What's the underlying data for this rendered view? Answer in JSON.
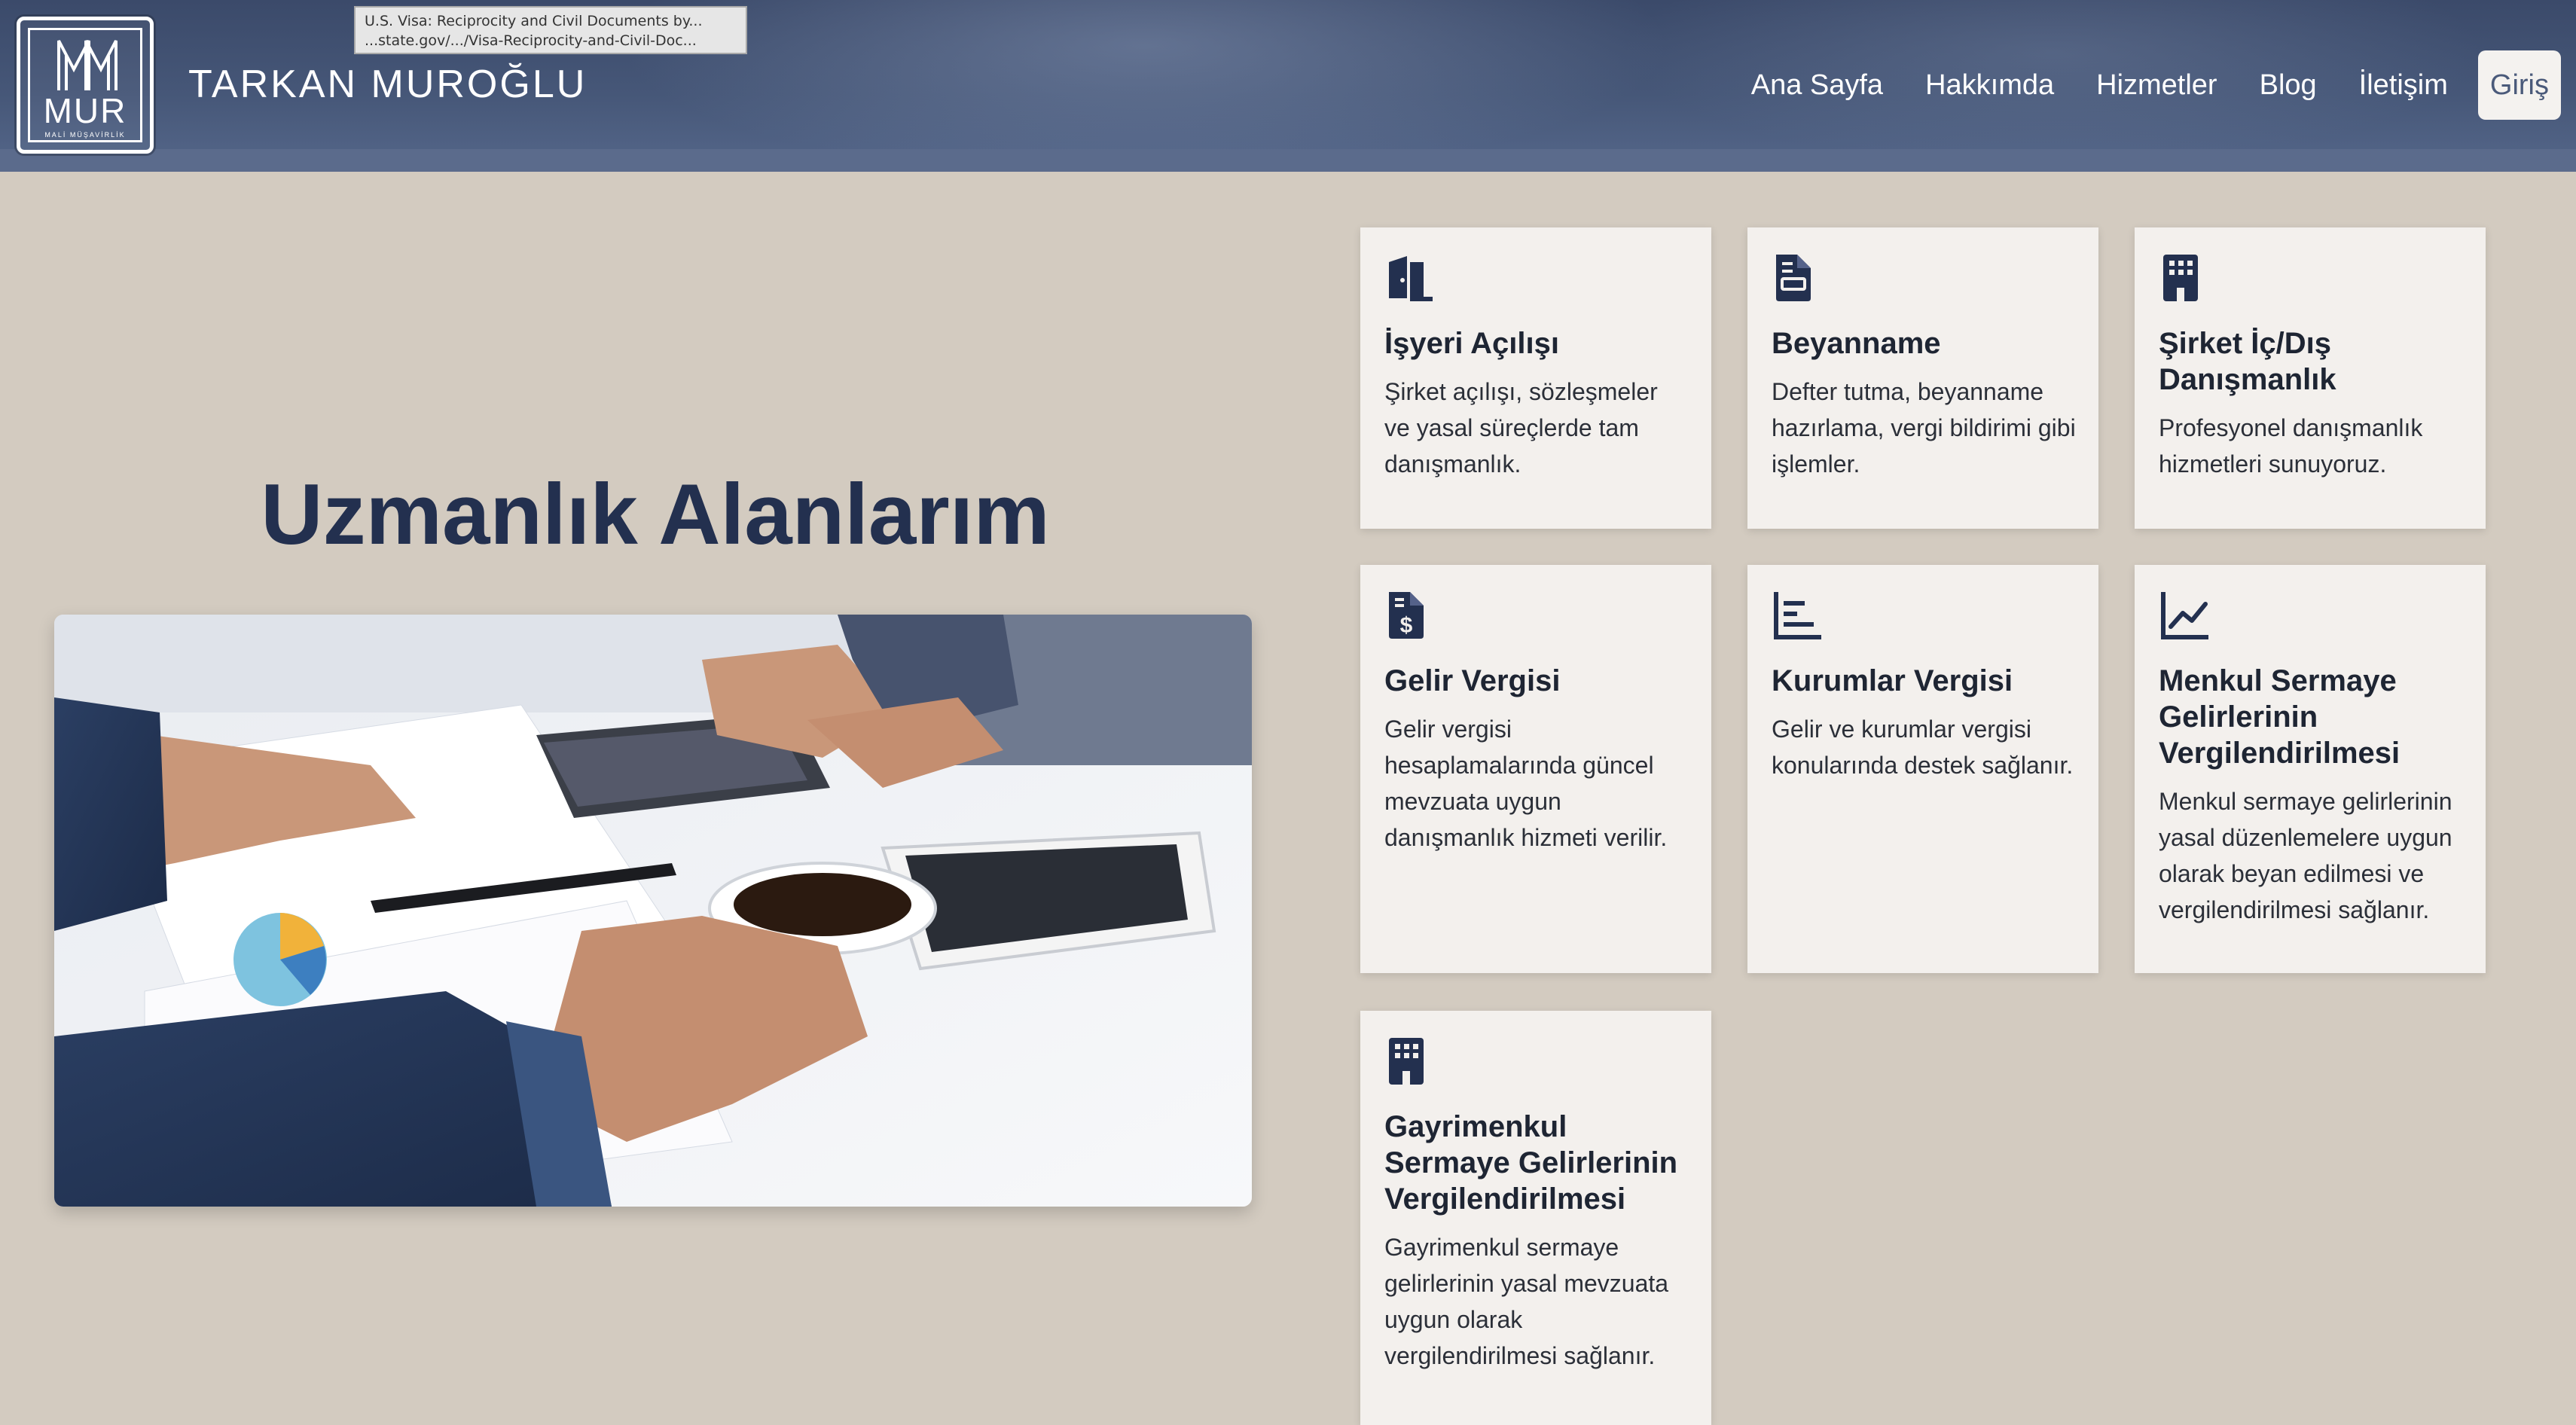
{
  "header": {
    "logo_text": "MUR",
    "logo_subtext": "MALİ MÜŞAVİRLİK",
    "site_name": "TARKAN MUROĞLU",
    "nav": {
      "home": "Ana Sayfa",
      "about": "Hakkımda",
      "services": "Hizmetler",
      "blog": "Blog",
      "contact": "İletişim",
      "login": "Giriş"
    }
  },
  "tooltip": {
    "line1": "U.S. Visa: Reciprocity and Civil Documents by...",
    "line2": "...state.gov/.../Visa-Reciprocity-and-Civil-Doc..."
  },
  "main": {
    "title_bold": "Uzmanlık",
    "title_regular": "Alanlarım"
  },
  "services": [
    {
      "icon": "door-icon",
      "title": "İşyeri Açılışı",
      "description": "Şirket açılışı, sözleşmeler ve yasal süreçlerde tam danışmanlık."
    },
    {
      "icon": "document-icon",
      "title": "Beyanname",
      "description": "Defter tutma, beyanname hazırlama, vergi bildirimi gibi işlemler."
    },
    {
      "icon": "building-icon",
      "title": "Şirket İç/Dış Danışmanlık",
      "description": "Profesyonel danışmanlık hizmetleri sunuyoruz."
    },
    {
      "icon": "invoice-dollar-icon",
      "title": "Gelir Vergisi",
      "description": "Gelir vergisi hesaplamalarında güncel mevzuata uygun danışmanlık hizmeti verilir."
    },
    {
      "icon": "bar-chart-icon",
      "title": "Kurumlar Vergisi",
      "description": "Gelir ve kurumlar vergisi konularında destek sağlanır."
    },
    {
      "icon": "line-chart-icon",
      "title": "Menkul Sermaye Gelirlerinin Vergilendirilmesi",
      "description": "Menkul sermaye gelirlerinin yasal düzenlemelere uygun olarak beyan edilmesi ve vergilendirilmesi sağlanır."
    },
    {
      "icon": "building-icon",
      "title": "Gayrimenkul Sermaye Gelirlerinin Vergilendirilmesi",
      "description": "Gayrimenkul sermaye gelirlerinin yasal mevzuata uygun olarak vergilendirilmesi sağlanır."
    }
  ],
  "colors": {
    "background": "#d3cbc0",
    "header": "#465778",
    "card": "#f3f0ed",
    "title": "#23304f",
    "icon": "#23304f"
  }
}
